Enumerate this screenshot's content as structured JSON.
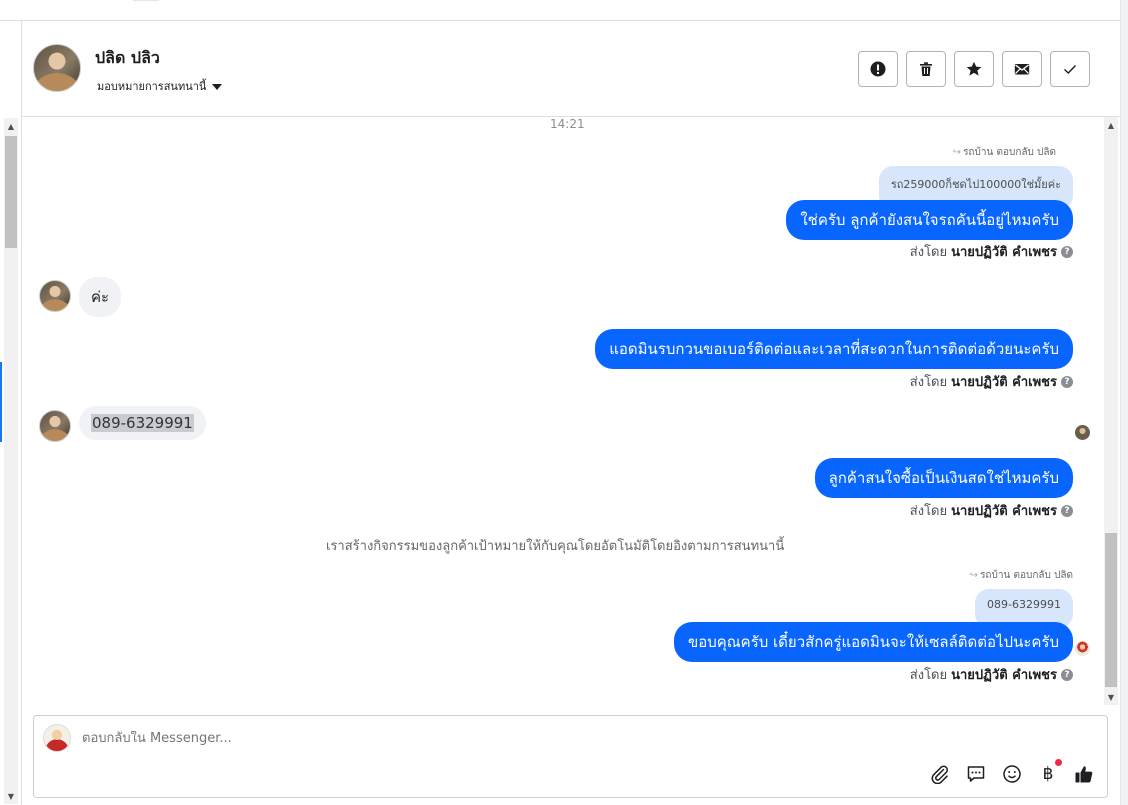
{
  "header": {
    "contact_name": "ปลิด ปลิว",
    "assign_label": "มอบหมายการสนทนานี้",
    "actions": [
      {
        "icon": "alert-icon"
      },
      {
        "icon": "trash-icon"
      },
      {
        "icon": "star-icon"
      },
      {
        "icon": "envelope-icon"
      },
      {
        "icon": "check-icon"
      }
    ]
  },
  "thread": {
    "timestamp": "14:21",
    "messages": [
      {
        "reply_note": "รถบ้าน ตอบกลับ ปลิด",
        "quoted": "รถ259000ก็ชดไป100000ใช่มั้ยค่ะ",
        "text": "ใช่ครับ ลูกค้ายังสนใจรถคันนี้อยู่ไหมครับ",
        "sent_by_prefix": "ส่งโดย",
        "sent_by": "นายปฏิวัติ คำเพชร"
      },
      {
        "incoming": "ค่ะ"
      },
      {
        "text": "แอดมินรบกวนขอเบอร์ติดต่อและเวลาที่สะดวกในการติดต่อด้วยนะครับ",
        "sent_by_prefix": "ส่งโดย",
        "sent_by": "นายปฏิวัติ คำเพชร"
      },
      {
        "incoming": "089-6329991"
      },
      {
        "text": "ลูกค้าสนใจซื้อเป็นเงินสดใช่ไหมครับ",
        "sent_by_prefix": "ส่งโดย",
        "sent_by": "นายปฏิวัติ คำเพชร"
      },
      {
        "system": "เราสร้างกิจกรรมของลูกค้าเป้าหมายให้กับคุณโดยอัตโนมัติโดยอิงตามการสนทนานี้"
      },
      {
        "reply_note": "รถบ้าน ตอบกลับ ปลิด",
        "quoted": "089-6329991",
        "text": "ขอบคุณครับ เดี๋ยวสักครู่แอดมินจะให้เซลล์ติดต่อไปนะครับ",
        "sent_by_prefix": "ส่งโดย",
        "sent_by": "นายปฏิวัติ คำเพชร"
      }
    ]
  },
  "composer": {
    "placeholder": "ตอบกลับใน Messenger...",
    "tools": [
      "paperclip-icon",
      "speech-bubble-icon",
      "emoji-icon",
      "baht-icon",
      "thumbs-up-icon"
    ],
    "currency_symbol": "฿"
  },
  "colors": {
    "outgoing_bubble": "#0866ff",
    "incoming_bubble": "#f0f2f5",
    "quoted_bubble": "#d8e6fb",
    "notification_dot": "#f02849"
  }
}
